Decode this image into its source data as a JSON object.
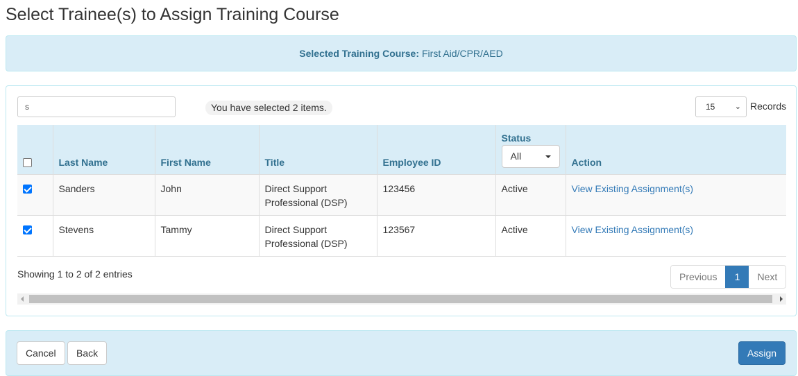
{
  "page": {
    "title": "Select Trainee(s) to Assign Training Course"
  },
  "course_banner": {
    "label": "Selected Training Course:",
    "value": "First Aid/CPR/AED"
  },
  "toolbar": {
    "search_value": "s",
    "selected_info": "You have selected 2 items.",
    "records_value": "15",
    "records_label": "Records"
  },
  "table": {
    "headers": {
      "last_name": "Last Name",
      "first_name": "First Name",
      "title": "Title",
      "employee_id": "Employee ID",
      "status": "Status",
      "status_filter": "All",
      "action": "Action"
    },
    "select_all_checked": false,
    "rows": [
      {
        "checked": true,
        "last_name": "Sanders",
        "first_name": "John",
        "title": "Direct Support Professional (DSP)",
        "employee_id": "123456",
        "status": "Active",
        "action": "View Existing Assignment(s)"
      },
      {
        "checked": true,
        "last_name": "Stevens",
        "first_name": "Tammy",
        "title": "Direct Support Professional (DSP)",
        "employee_id": "123567",
        "status": "Active",
        "action": "View Existing Assignment(s)"
      }
    ]
  },
  "pagination": {
    "showing": "Showing 1 to 2 of 2 entries",
    "previous": "Previous",
    "current_page": "1",
    "next": "Next"
  },
  "footer": {
    "cancel": "Cancel",
    "back": "Back",
    "assign": "Assign"
  },
  "colors": {
    "info_bg": "#d9edf7",
    "info_text": "#31708f",
    "primary": "#337ab7",
    "checkbox_checked": "#0075ff"
  }
}
